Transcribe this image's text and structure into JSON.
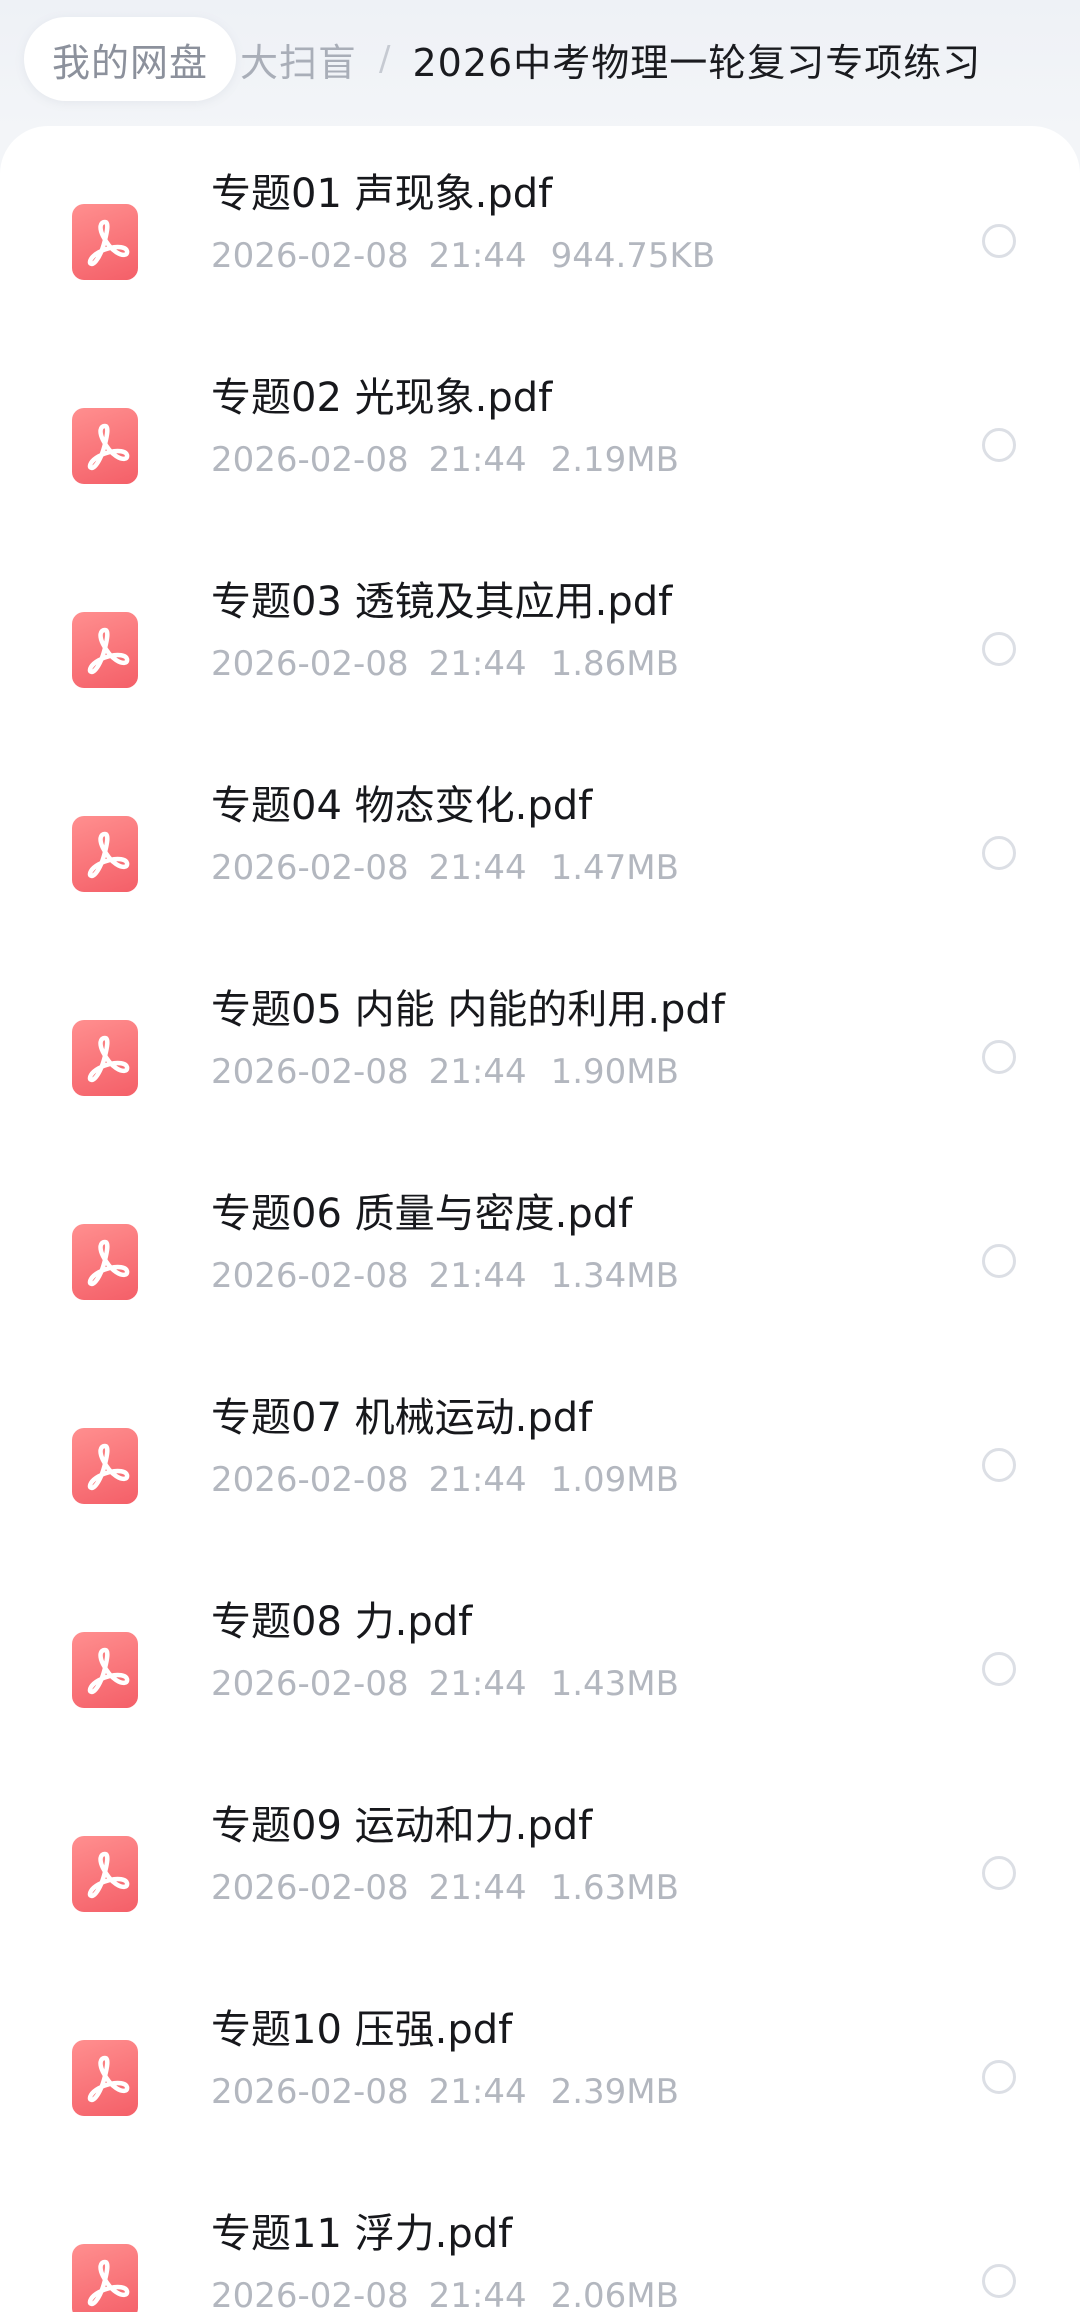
{
  "breadcrumb": {
    "root": "我的网盘",
    "parent": "大扫盲",
    "separator": "/",
    "current": "2026中考物理一轮复习专项练习"
  },
  "file_icon": "pdf-file-icon",
  "accent_color": "#f45f68",
  "files": [
    {
      "name": "专题01 声现象.pdf",
      "date": "2026-02-08",
      "time": "21:44",
      "size": "944.75KB"
    },
    {
      "name": "专题02 光现象.pdf",
      "date": "2026-02-08",
      "time": "21:44",
      "size": "2.19MB"
    },
    {
      "name": "专题03 透镜及其应用.pdf",
      "date": "2026-02-08",
      "time": "21:44",
      "size": "1.86MB"
    },
    {
      "name": "专题04 物态变化.pdf",
      "date": "2026-02-08",
      "time": "21:44",
      "size": "1.47MB"
    },
    {
      "name": "专题05 内能 内能的利用.pdf",
      "date": "2026-02-08",
      "time": "21:44",
      "size": "1.90MB"
    },
    {
      "name": "专题06 质量与密度.pdf",
      "date": "2026-02-08",
      "time": "21:44",
      "size": "1.34MB"
    },
    {
      "name": "专题07 机械运动.pdf",
      "date": "2026-02-08",
      "time": "21:44",
      "size": "1.09MB"
    },
    {
      "name": "专题08 力.pdf",
      "date": "2026-02-08",
      "time": "21:44",
      "size": "1.43MB"
    },
    {
      "name": "专题09 运动和力.pdf",
      "date": "2026-02-08",
      "time": "21:44",
      "size": "1.63MB"
    },
    {
      "name": "专题10 压强.pdf",
      "date": "2026-02-08",
      "time": "21:44",
      "size": "2.39MB"
    },
    {
      "name": "专题11 浮力.pdf",
      "date": "2026-02-08",
      "time": "21:44",
      "size": "2.06MB"
    }
  ]
}
